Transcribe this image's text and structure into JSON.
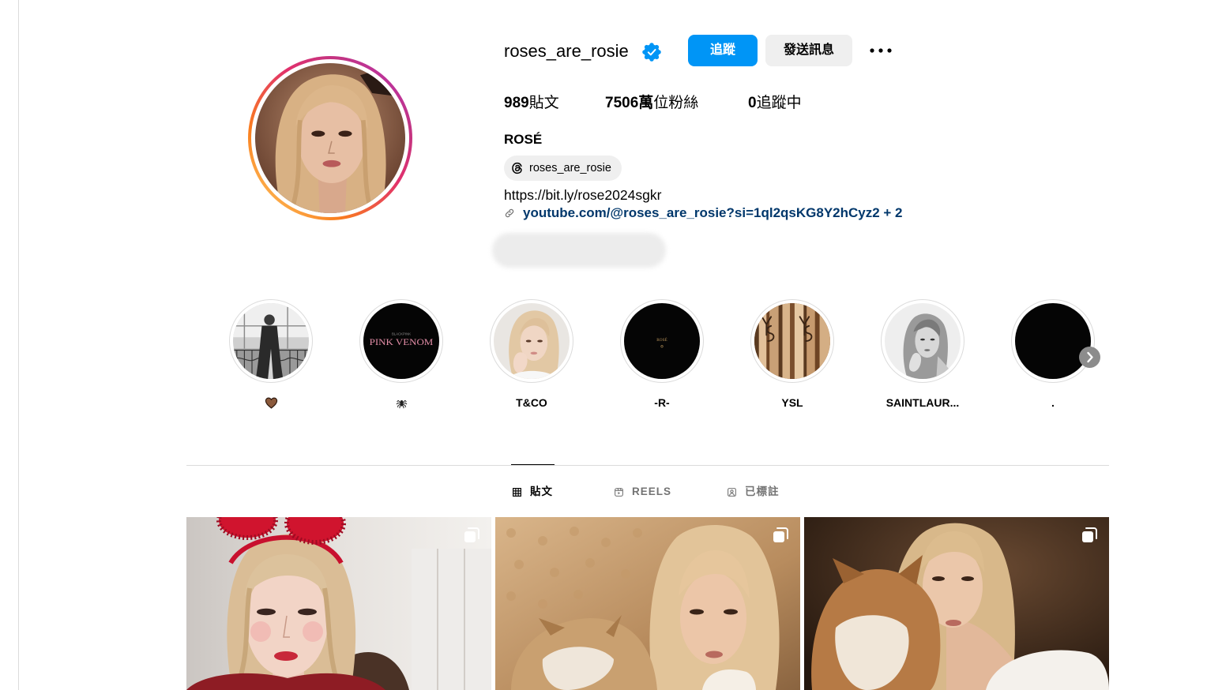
{
  "profile": {
    "username": "roses_are_rosie",
    "verified": true,
    "verified_icon": "verified-badge-icon",
    "follow_label": "追蹤",
    "message_label": "發送訊息",
    "more_icon": "more-options-icon",
    "stats": [
      {
        "value": "989",
        "label": "貼文"
      },
      {
        "value": "7506萬",
        "label": "位粉絲"
      },
      {
        "value": "0",
        "label": "追蹤中"
      }
    ],
    "display_name": "ROSÉ",
    "threads_icon": "threads-icon",
    "threads_handle": "roses_are_rosie",
    "bio_link": "https://bit.ly/rose2024sgkr",
    "link_icon": "link-icon",
    "external_link": "youtube.com/@roses_are_rosie?si=1ql2qsKG8Y2hCyz2 + 2"
  },
  "highlights": [
    {
      "label_icon": "brown-heart-icon"
    },
    {
      "label_icon": "spider-icon",
      "cover_text": {
        "small": "BLACKPINK",
        "title": "PINK VENOM"
      }
    },
    {
      "label": "T&CO"
    },
    {
      "label": "-R-",
      "cover_text": {
        "title": "ROSÉ"
      }
    },
    {
      "label": "YSL"
    },
    {
      "label": "SAINTLAUR..."
    },
    {
      "label": "."
    }
  ],
  "highlights_next_icon": "chevron-right-icon",
  "tabs": [
    {
      "label": "貼文",
      "icon": "grid-icon",
      "active": true
    },
    {
      "label": "REELS",
      "icon": "reels-icon",
      "active": false
    },
    {
      "label": "已標註",
      "icon": "tagged-icon",
      "active": false
    }
  ],
  "posts": [
    {
      "carousel": true,
      "badge_icon": "multiple-photos-icon"
    },
    {
      "carousel": true,
      "badge_icon": "multiple-photos-icon"
    },
    {
      "carousel": true,
      "badge_icon": "multiple-photos-icon"
    }
  ],
  "colors": {
    "accent": "#0095f6",
    "link": "#00376b",
    "secondary_button": "#efefef",
    "divider": "#dbdbdb",
    "muted_text": "#737373"
  }
}
